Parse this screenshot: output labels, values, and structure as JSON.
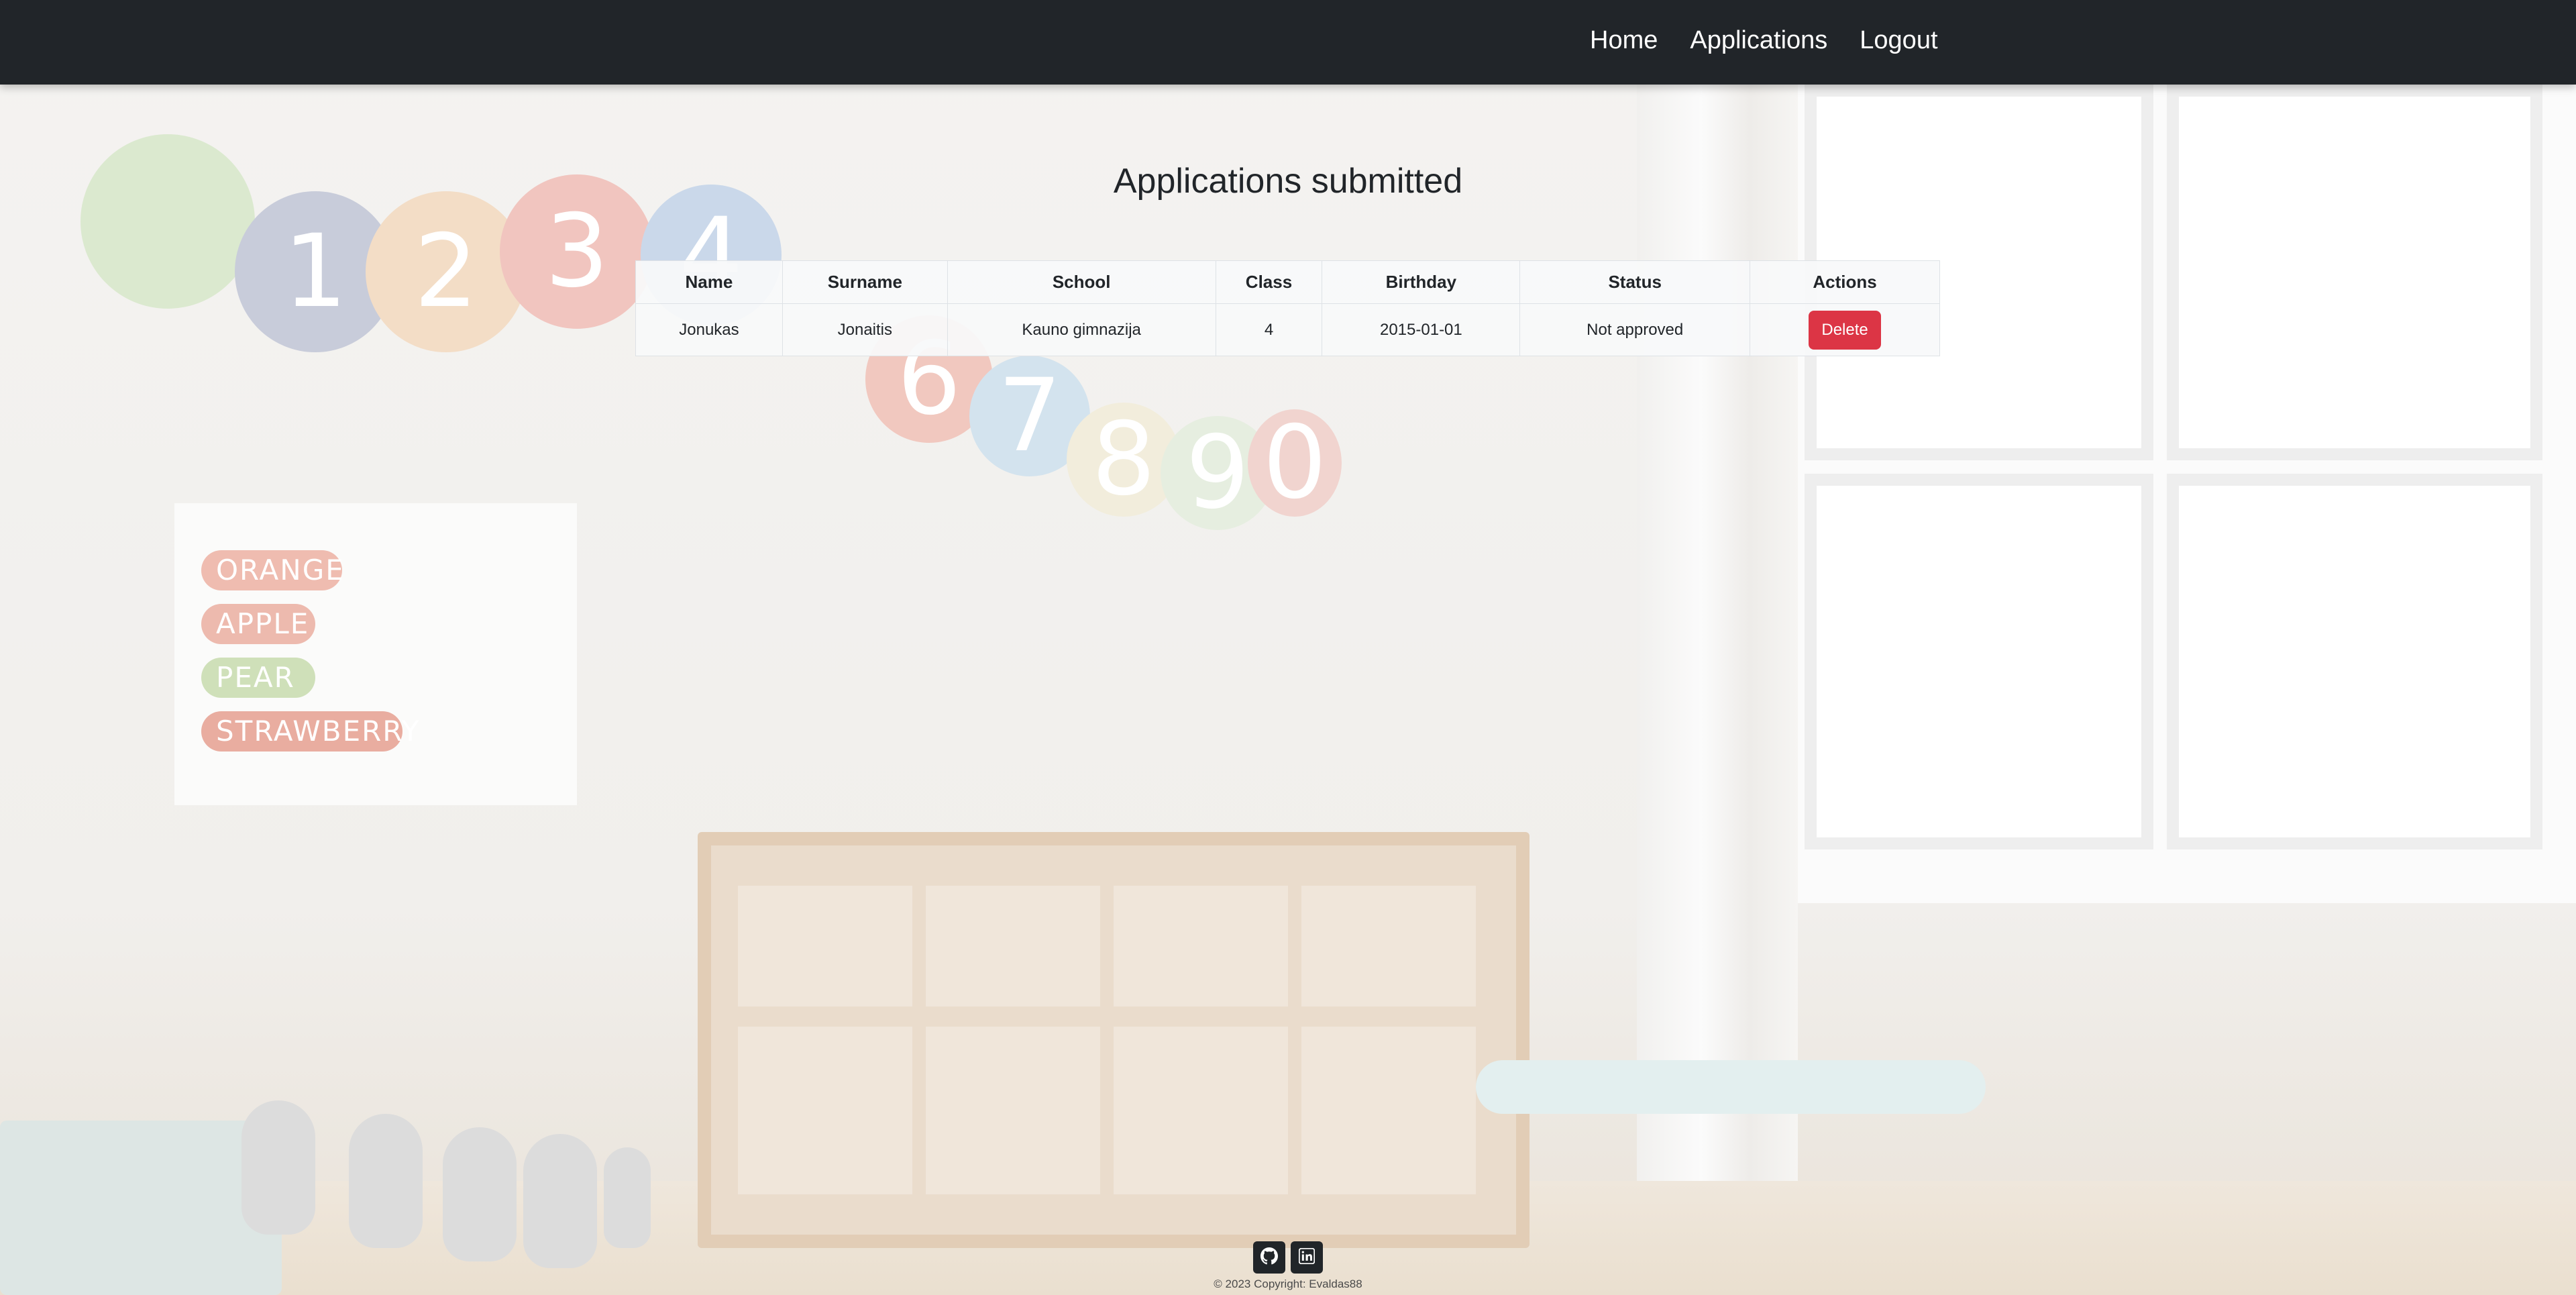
{
  "nav": {
    "links": [
      {
        "label": "Home"
      },
      {
        "label": "Applications"
      },
      {
        "label": "Logout"
      }
    ]
  },
  "main": {
    "title": "Applications submitted",
    "table": {
      "headers": [
        "Name",
        "Surname",
        "School",
        "Class",
        "Birthday",
        "Status",
        "Actions"
      ],
      "rows": [
        {
          "name": "Jonukas",
          "surname": "Jonaitis",
          "school": "Kauno gimnazija",
          "class": "4",
          "birthday": "2015-01-01",
          "status": "Not approved",
          "action_label": "Delete"
        }
      ]
    }
  },
  "background": {
    "poster_words": [
      "ORANGE",
      "APPLE",
      "PEAR",
      "STRAWBERRY"
    ],
    "caterpillar_numbers": [
      "1",
      "2",
      "3",
      "4",
      "6",
      "7",
      "8",
      "9",
      "0"
    ]
  },
  "footer": {
    "social_icons": [
      "github-icon",
      "linkedin-icon"
    ],
    "copyright": "© 2023 Copyright: Evaldas88"
  },
  "colors": {
    "navbar": "#212529",
    "danger": "#dc3545",
    "text": "#212529"
  }
}
